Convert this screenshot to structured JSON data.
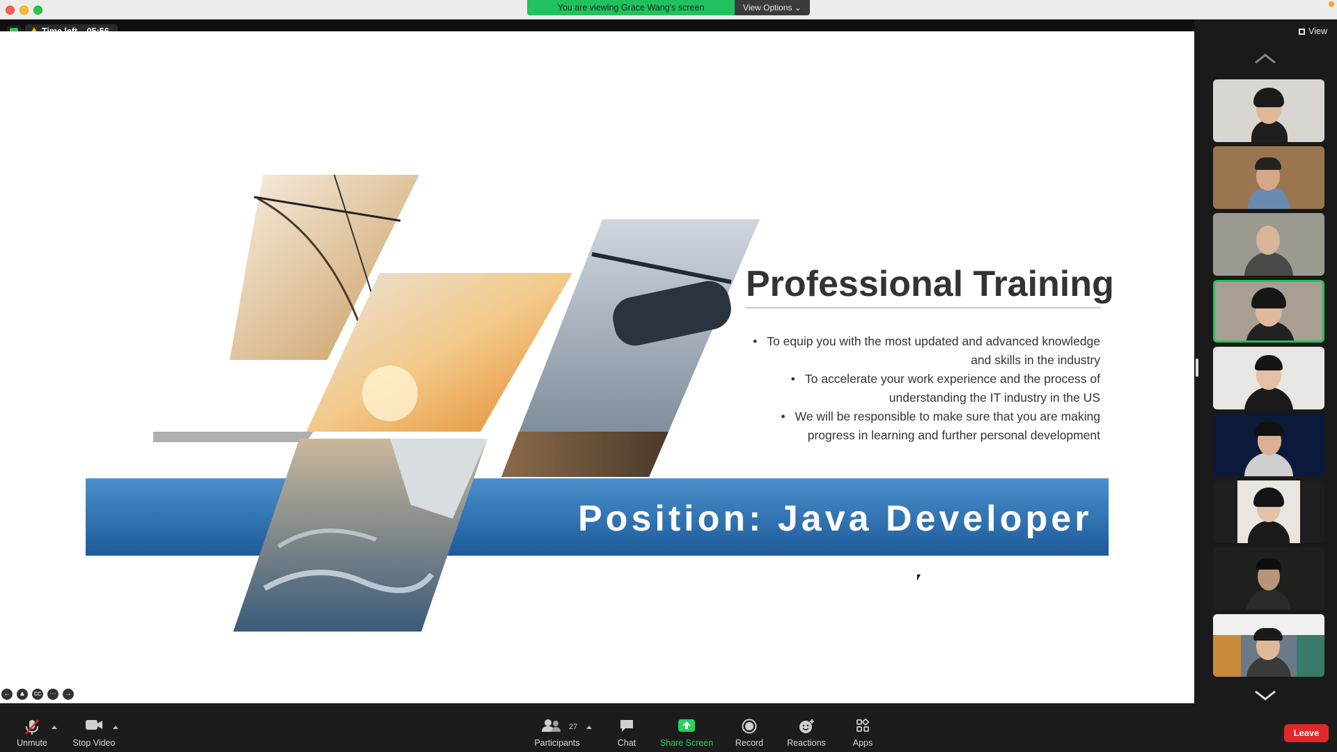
{
  "window": {
    "viewing_banner": "You are viewing Grace Wang's screen",
    "view_options": "View Options",
    "time_left_label": "Time left",
    "time_left_value": "05:56",
    "view_label": "View"
  },
  "slide": {
    "title": "Professional Training",
    "bullets": [
      "To equip you with the most updated and advanced knowledge and skills in the industry",
      "To accelerate your work experience and the process of understanding the IT industry in the US",
      "We will be responsible to make sure that you are making progress in learning and further personal development"
    ],
    "bullet_lines": [
      [
        "To equip you with the most updated and advanced knowledge",
        "and skills in the industry"
      ],
      [
        "To accelerate your work experience and the process of",
        "understanding the IT industry in the US"
      ],
      [
        "We will be responsible to make sure that you are making",
        "progress in learning and further personal development"
      ]
    ],
    "banner": "Position: Java Developer"
  },
  "toolbar": {
    "unmute": "Unmute",
    "stop_video": "Stop Video",
    "participants": "Participants",
    "participant_count": "27",
    "chat": "Chat",
    "share_screen": "Share Screen",
    "record": "Record",
    "reactions": "Reactions",
    "apps": "Apps",
    "leave": "Leave"
  },
  "colors": {
    "share_green": "#29d15f",
    "leave_red": "#e02828",
    "banner_blue": "#2f78b8",
    "active_speaker_border": "#25c05b"
  },
  "gallery": {
    "participant_tiles": 9,
    "active_tile_index": 3
  }
}
